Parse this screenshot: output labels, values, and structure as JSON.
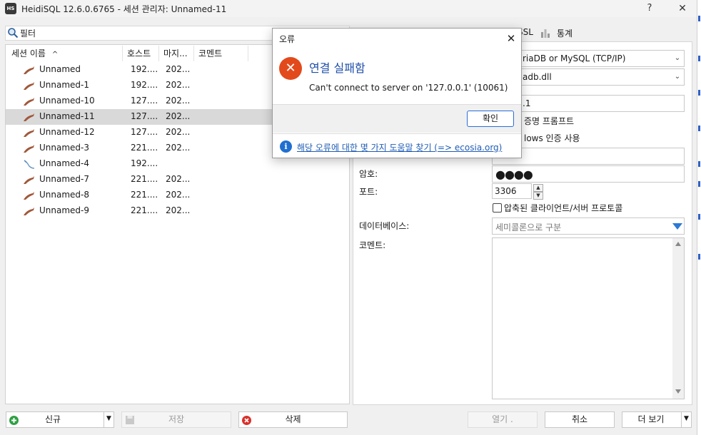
{
  "window": {
    "app_icon_text": "HS",
    "title": "HeidiSQL 12.6.0.6765 - 세션 관리자: Unnamed-11",
    "help_label": "?",
    "close_label": "✕"
  },
  "filter": {
    "label": "필터",
    "icon": "search-icon"
  },
  "session_list": {
    "columns": [
      "세션 이름",
      "호스트",
      "마지...",
      "코멘트"
    ],
    "sort_indicator": "^",
    "rows": [
      {
        "name": "Unnamed",
        "host": "192....",
        "date": "202..."
      },
      {
        "name": "Unnamed-1",
        "host": "192....",
        "date": "202..."
      },
      {
        "name": "Unnamed-10",
        "host": "127....",
        "date": "202..."
      },
      {
        "name": "Unnamed-11",
        "host": "127....",
        "date": "202..."
      },
      {
        "name": "Unnamed-12",
        "host": "127....",
        "date": "202..."
      },
      {
        "name": "Unnamed-3",
        "host": "221....",
        "date": "202..."
      },
      {
        "name": "Unnamed-4",
        "host": "192....",
        "date": ""
      },
      {
        "name": "Unnamed-7",
        "host": "221....",
        "date": "202..."
      },
      {
        "name": "Unnamed-8",
        "host": "221....",
        "date": "202..."
      },
      {
        "name": "Unnamed-9",
        "host": "221....",
        "date": "202..."
      }
    ],
    "selected_index": 3
  },
  "tabs": {
    "ssl": "SSL",
    "stats": "통계"
  },
  "settings": {
    "network_type": "riaDB or MySQL (TCP/IP)",
    "library": "adb.dll",
    "hostname": ".1",
    "prompt_checkbox_label": "증명 프롬프트",
    "windows_auth_label": "lows 인증 사용",
    "password_label": "암호:",
    "password_value": "●●●●",
    "port_label": "포트:",
    "port_value": "3306",
    "compressed_label": "압축된 클라이언트/서버 프로토콜",
    "database_label": "데이터베이스:",
    "database_placeholder": "세미콜론으로 구분",
    "comment_label": "코멘트:"
  },
  "buttons": {
    "new": "신규",
    "save": "저장",
    "delete": "삭제",
    "open": "열기 .",
    "cancel": "취소",
    "more": "더 보기"
  },
  "dialog": {
    "title": "오류",
    "heading": "연결 실패함",
    "message": "Can't connect to server on '127.0.0.1' (10061)",
    "ok_label": "확인",
    "help_link": "해당 오류에 대한 몇 가지 도움말 찾기 (=> ecosia.org)",
    "info_glyph": "i",
    "error_glyph": "✕"
  },
  "colors": {
    "accent": "#2a6fd6",
    "error": "#e24a1c",
    "link": "#1f5db5",
    "selected_row": "#d9d9d9"
  }
}
